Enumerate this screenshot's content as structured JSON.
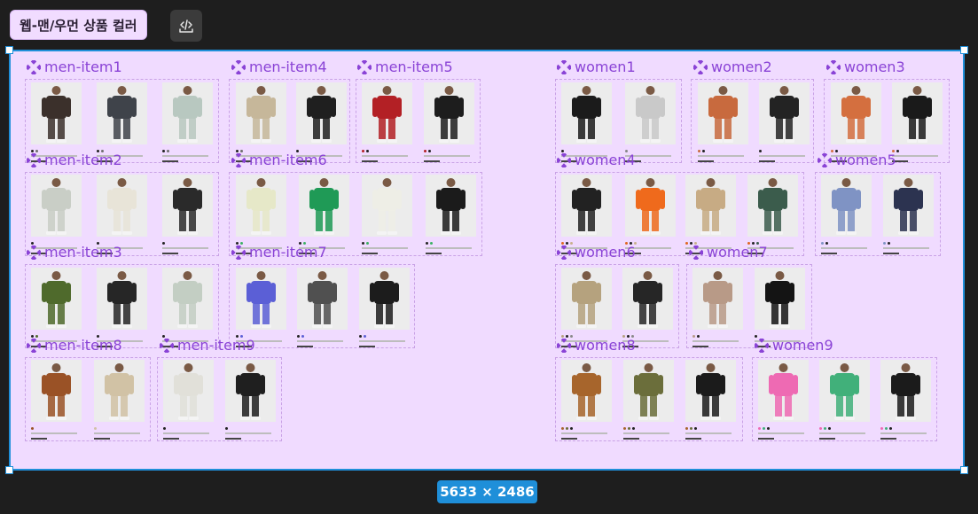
{
  "page": {
    "frame_label": "웹-맨/우먼 상품 컬러",
    "dimensions_label": "5633 × 2486",
    "code_button_icon": "code-view-icon",
    "component_icon": "component-icon"
  },
  "colors": {
    "canvas_bg": "#1e1e1e",
    "frame_bg": "#f0dbff",
    "selection": "#1f8fd9",
    "component_label": "#8a43d6",
    "card_border": "#c9a2e6"
  },
  "components": [
    {
      "label": "men-item1",
      "products": [
        {
          "garment": "#3b302b",
          "dots": [
            "#222222",
            "#6e6e6e"
          ]
        },
        {
          "garment": "#3f434a",
          "dots": [
            "#222222",
            "#6e6e6e"
          ]
        },
        {
          "garment": "#b8c8c0",
          "dots": [
            "#222222",
            "#6e6e6e"
          ]
        }
      ]
    },
    {
      "label": "men-item4",
      "products": [
        {
          "garment": "#c6b79a",
          "dots": [
            "#222222",
            "#6e6e6e"
          ]
        },
        {
          "garment": "#1f1f1f",
          "dots": [
            "#222222"
          ]
        }
      ]
    },
    {
      "label": "men-item5",
      "products": [
        {
          "garment": "#b32025",
          "dots": [
            "#b32025",
            "#222222"
          ]
        },
        {
          "garment": "#1d1d1d",
          "dots": [
            "#b32025",
            "#222222"
          ]
        }
      ]
    },
    {
      "label": "women1",
      "products": [
        {
          "garment": "#1b1b1b",
          "dots": [
            "#222222"
          ]
        },
        {
          "garment": "#c9c9c9",
          "dots": [
            "#888888"
          ]
        }
      ]
    },
    {
      "label": "women2",
      "products": [
        {
          "garment": "#c86a3e",
          "dots": [
            "#c86a3e",
            "#222222"
          ]
        },
        {
          "garment": "#232323",
          "dots": [
            "#222222"
          ]
        }
      ]
    },
    {
      "label": "women3",
      "products": [
        {
          "garment": "#d46f3f",
          "dots": [
            "#d46f3f",
            "#222222"
          ]
        },
        {
          "garment": "#1a1a1a",
          "dots": [
            "#d46f3f",
            "#222222"
          ]
        }
      ]
    },
    {
      "label": "men-item2",
      "products": [
        {
          "garment": "#c9cec6",
          "dots": [
            "#222222"
          ]
        },
        {
          "garment": "#e8e4d8",
          "dots": [
            "#222222"
          ]
        },
        {
          "garment": "#2a2a2a",
          "dots": [
            "#222222"
          ]
        }
      ]
    },
    {
      "label": "men-item6",
      "products": [
        {
          "garment": "#e6e8c8",
          "dots": [
            "#222222",
            "#3bb063"
          ]
        },
        {
          "garment": "#1f9a56",
          "dots": [
            "#222222",
            "#3bb063"
          ]
        },
        {
          "garment": "#eeeee6",
          "dots": [
            "#222222",
            "#3bb063"
          ]
        },
        {
          "garment": "#1b1b1b",
          "dots": [
            "#222222",
            "#3bb063"
          ]
        }
      ]
    },
    {
      "label": "women4",
      "products": [
        {
          "garment": "#222222",
          "dots": [
            "#e0661e",
            "#222222",
            "#c9b08c"
          ]
        },
        {
          "garment": "#ef6a1c",
          "dots": [
            "#e0661e",
            "#222222",
            "#c9b08c"
          ]
        },
        {
          "garment": "#c7ab84",
          "dots": [
            "#e0661e",
            "#222222",
            "#c9b08c"
          ]
        },
        {
          "garment": "#3b5c4c",
          "dots": [
            "#e0661e",
            "#222222",
            "#3b5c4c"
          ]
        }
      ]
    },
    {
      "label": "women5",
      "products": [
        {
          "garment": "#7f93c4",
          "dots": [
            "#7f93c4",
            "#222222"
          ]
        },
        {
          "garment": "#2c3350",
          "dots": [
            "#7f93c4",
            "#222222"
          ]
        }
      ]
    },
    {
      "label": "men-item3",
      "products": [
        {
          "garment": "#4f6a2c",
          "dots": [
            "#222222",
            "#4f6a2c"
          ]
        },
        {
          "garment": "#262626",
          "dots": [
            "#222222"
          ]
        },
        {
          "garment": "#c3cec3",
          "dots": [
            "#222222"
          ]
        }
      ]
    },
    {
      "label": "men-item7",
      "products": [
        {
          "garment": "#5b5fd6",
          "dots": [
            "#222222",
            "#5b5fd6"
          ]
        },
        {
          "garment": "#505050",
          "dots": [
            "#222222",
            "#5b5fd6"
          ]
        },
        {
          "garment": "#1c1c1c",
          "dots": [
            "#222222",
            "#5b5fd6"
          ]
        }
      ]
    },
    {
      "label": "women6",
      "products": [
        {
          "garment": "#b5a27e",
          "dots": [
            "#b5a27e",
            "#222222",
            "#888888"
          ]
        },
        {
          "garment": "#262626",
          "dots": [
            "#b5a27e",
            "#222222",
            "#888888"
          ]
        }
      ]
    },
    {
      "label": "women7",
      "products": [
        {
          "garment": "#b89a87",
          "dots": [
            "#b89a87",
            "#222222"
          ]
        },
        {
          "garment": "#141414",
          "dots": [
            "#222222"
          ]
        }
      ]
    },
    {
      "label": "men-item8",
      "products": [
        {
          "garment": "#9a5226",
          "dots": [
            "#9a5226"
          ]
        },
        {
          "garment": "#d1c2a5",
          "dots": [
            "#d1c2a5"
          ]
        }
      ]
    },
    {
      "label": "men-item9",
      "products": [
        {
          "garment": "#e1e0d9",
          "dots": [
            "#222222"
          ]
        },
        {
          "garment": "#1f1f1f",
          "dots": [
            "#222222"
          ]
        }
      ]
    },
    {
      "label": "women8",
      "products": [
        {
          "garment": "#a7652c",
          "dots": [
            "#a7652c",
            "#6a6e3a",
            "#222222"
          ]
        },
        {
          "garment": "#6b6e3b",
          "dots": [
            "#a7652c",
            "#6a6e3a",
            "#222222"
          ]
        },
        {
          "garment": "#1b1b1b",
          "dots": [
            "#a7652c",
            "#6a6e3a",
            "#222222"
          ]
        }
      ]
    },
    {
      "label": "women9",
      "products": [
        {
          "garment": "#ee6ab3",
          "dots": [
            "#ee6ab3",
            "#41b07a",
            "#222222"
          ]
        },
        {
          "garment": "#41b07a",
          "dots": [
            "#ee6ab3",
            "#41b07a",
            "#222222"
          ]
        },
        {
          "garment": "#1b1b1b",
          "dots": [
            "#ee6ab3",
            "#41b07a",
            "#222222"
          ]
        }
      ]
    }
  ]
}
